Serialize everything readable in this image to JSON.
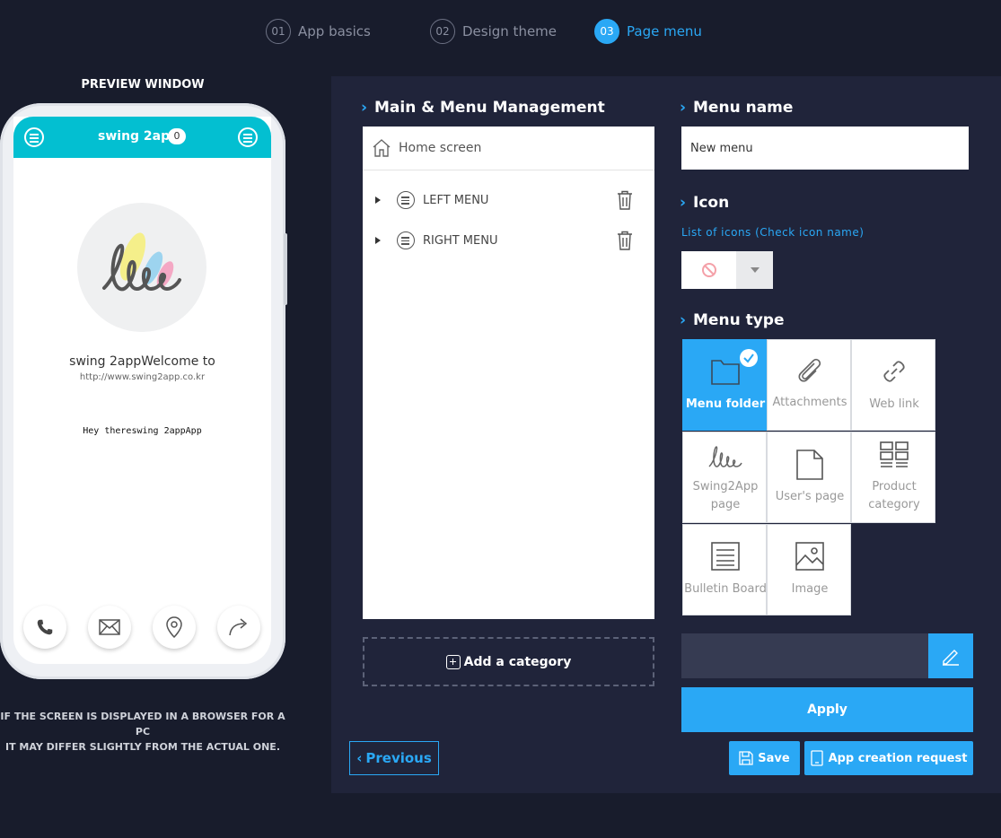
{
  "steps": [
    {
      "num": "01",
      "label": "App basics",
      "active": false
    },
    {
      "num": "02",
      "label": "Design theme",
      "active": false
    },
    {
      "num": "03",
      "label": "Page menu",
      "active": true
    }
  ],
  "preview": {
    "title": "PREVIEW WINDOW",
    "app_title": "swing 2app",
    "badge_count": "0",
    "app_name": "swing 2appWelcome to",
    "app_url": "http://www.swing2app.co.kr",
    "greeting": "Hey thereswing 2appApp",
    "bottom_buttons": [
      "phone-icon",
      "mail-icon",
      "location-pin-icon",
      "share-icon"
    ],
    "disclaimer_line1": "IF THE SCREEN IS DISPLAYED IN A BROWSER FOR A PC",
    "disclaimer_line2": "IT MAY DIFFER SLIGHTLY FROM THE ACTUAL ONE."
  },
  "menu_management": {
    "title": "Main & Menu Management",
    "home_label": "Home screen",
    "items": [
      {
        "label": "LEFT MENU"
      },
      {
        "label": "RIGHT MENU"
      }
    ],
    "add_category": "Add a category"
  },
  "menu_name": {
    "title": "Menu name",
    "value": "New menu"
  },
  "icon": {
    "title": "Icon",
    "list_link": "List of icons (Check icon name)",
    "selected": "none-icon"
  },
  "menu_type": {
    "title": "Menu type",
    "selected": "Menu folder",
    "tiles": [
      {
        "label": "Menu folder",
        "icon": "folder-icon"
      },
      {
        "label": "Attachments",
        "icon": "paperclip-icon"
      },
      {
        "label": "Web link",
        "icon": "link-icon"
      },
      {
        "label": "Swing2App page",
        "icon": "swing2app-logo-icon"
      },
      {
        "label": "User's page",
        "icon": "page-icon"
      },
      {
        "label": "Product category",
        "icon": "grid-icon"
      },
      {
        "label": "Bulletin Board",
        "icon": "board-icon"
      },
      {
        "label": "Image",
        "icon": "image-icon"
      }
    ]
  },
  "buttons": {
    "apply": "Apply",
    "previous": "Previous",
    "save": "Save",
    "app_request": "App creation request"
  },
  "colors": {
    "accent": "#2aa8f5",
    "background": "#181c2c",
    "panel": "#20243a",
    "phone_header": "#03bfd1"
  }
}
